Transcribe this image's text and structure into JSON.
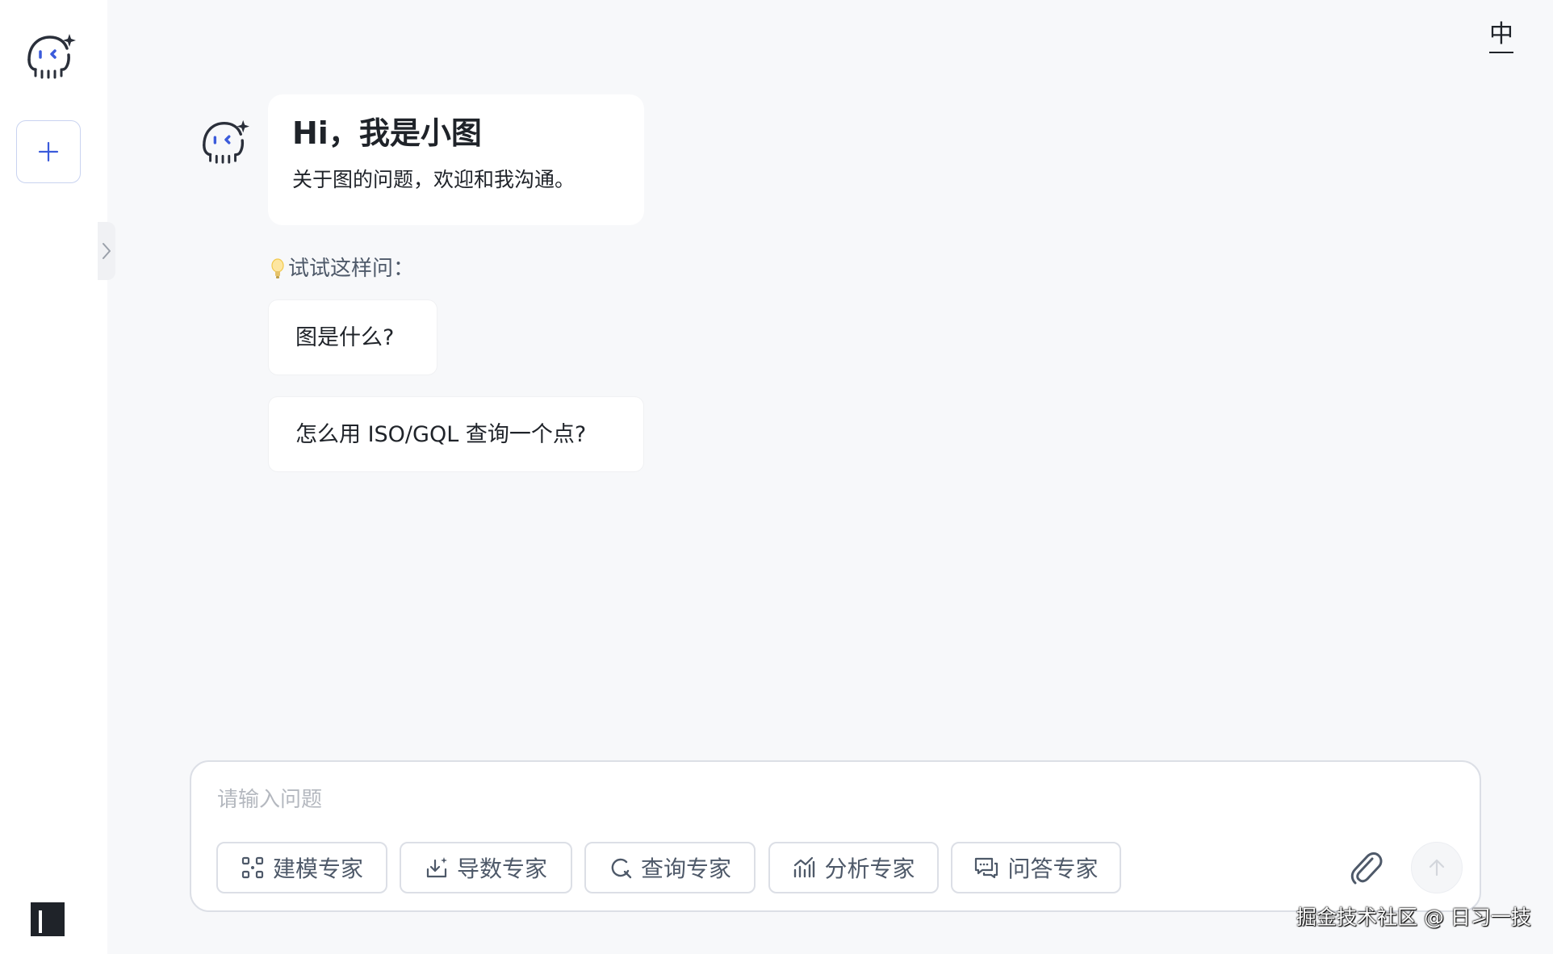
{
  "sidebar": {
    "logo": "octopus-bot-logo",
    "new_chat_icon": "plus-icon",
    "expand_icon": "chevron-right-icon",
    "layout_icon": "layout-icon"
  },
  "header": {
    "language_toggle": "中"
  },
  "chat": {
    "welcome_title": "Hi，我是小图",
    "welcome_subtitle": "关于图的问题，欢迎和我沟通。",
    "try_label": "试试这样问：",
    "suggestions": [
      "图是什么?",
      "怎么用 ISO/GQL 查询一个点?"
    ]
  },
  "composer": {
    "placeholder": "请输入问题",
    "experts": [
      {
        "label": "建模专家",
        "icon": "modeling-icon"
      },
      {
        "label": "导数专家",
        "icon": "import-icon"
      },
      {
        "label": "查询专家",
        "icon": "query-icon"
      },
      {
        "label": "分析专家",
        "icon": "analysis-icon"
      },
      {
        "label": "问答专家",
        "icon": "qa-icon"
      }
    ],
    "attach_icon": "paperclip-icon",
    "send_icon": "arrow-up-icon"
  },
  "watermark": "掘金技术社区 @ 日习一技",
  "colors": {
    "accent": "#3b5bdb",
    "background": "#f7f8fa",
    "panel": "#ffffff",
    "border": "#dcdfe6",
    "muted_text": "#4e5969",
    "placeholder": "#b4b8bf"
  }
}
